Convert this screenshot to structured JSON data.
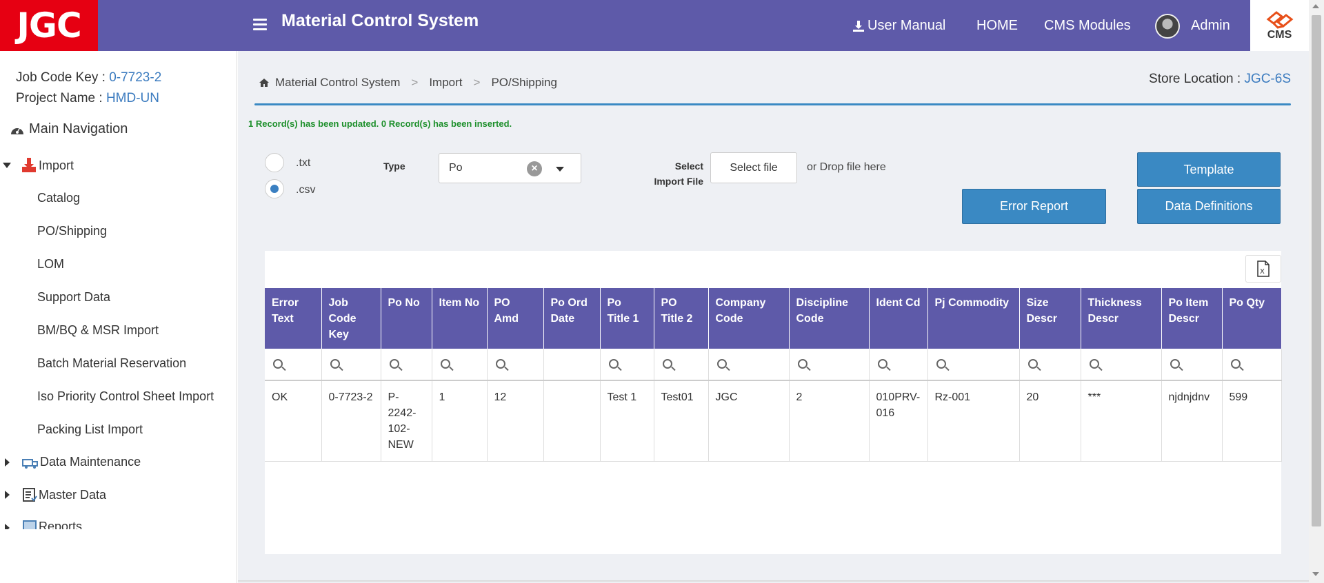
{
  "header": {
    "logo_text": "JGC",
    "app_title": "Material Control System",
    "nav": {
      "user_manual": "User Manual",
      "home": "HOME",
      "cms_modules": "CMS Modules",
      "user": "Admin"
    },
    "cms_logo_text": "CMS",
    "bg_color": "#5e5aa9",
    "logo_color": "#e60012"
  },
  "sidebar": {
    "job_code_label": "Job Code Key :",
    "job_code_value": "0-7723-2",
    "project_label": "Project Name :",
    "project_value": "HMD-UN",
    "main_nav": "Main Navigation",
    "import_label": "Import",
    "import_items": [
      "Catalog",
      "PO/Shipping",
      "LOM",
      "Support Data",
      "BM/BQ & MSR Import",
      "Batch Material Reservation",
      "Iso Priority Control Sheet Import",
      "Packing List Import"
    ],
    "data_maintenance": "Data Maintenance",
    "master_data": "Master Data",
    "reports_partial": "Reports"
  },
  "breadcrumb": [
    "Material Control System",
    "Import",
    "PO/Shipping"
  ],
  "store": {
    "label": "Store Location :",
    "value": "JGC-6S"
  },
  "message": "1 Record(s) has been updated. 0 Record(s) has been inserted.",
  "form": {
    "radio_txt": ".txt",
    "radio_csv": ".csv",
    "type_label": "Type",
    "type_value": "Po",
    "select_file_label_1": "Select",
    "select_file_label_2": "Import File",
    "select_file_button": "Select file",
    "drop_text": "or Drop file here",
    "template_button": "Template",
    "error_report_button": "Error Report",
    "data_definitions_button": "Data Definitions"
  },
  "grid": {
    "columns": [
      "Error Text",
      "Job Code Key",
      "Po No",
      "Item No",
      "PO Amd",
      "Po Ord Date",
      "Po Title 1",
      "PO Title 2",
      "Company Code",
      "Discipline Code",
      "Ident Cd",
      "Pj Commodity",
      "Size Descr",
      "Thickness Descr",
      "Po Item Descr",
      "Po Qty"
    ],
    "rows": [
      [
        "OK",
        "0-7723-2",
        "P-2242-102-NEW",
        "1",
        "12",
        "",
        "Test 1",
        "Test01",
        "JGC",
        "2",
        "010PRV-016",
        "Rz-001",
        "20",
        "***",
        "njdnjdnv",
        "599"
      ]
    ]
  }
}
